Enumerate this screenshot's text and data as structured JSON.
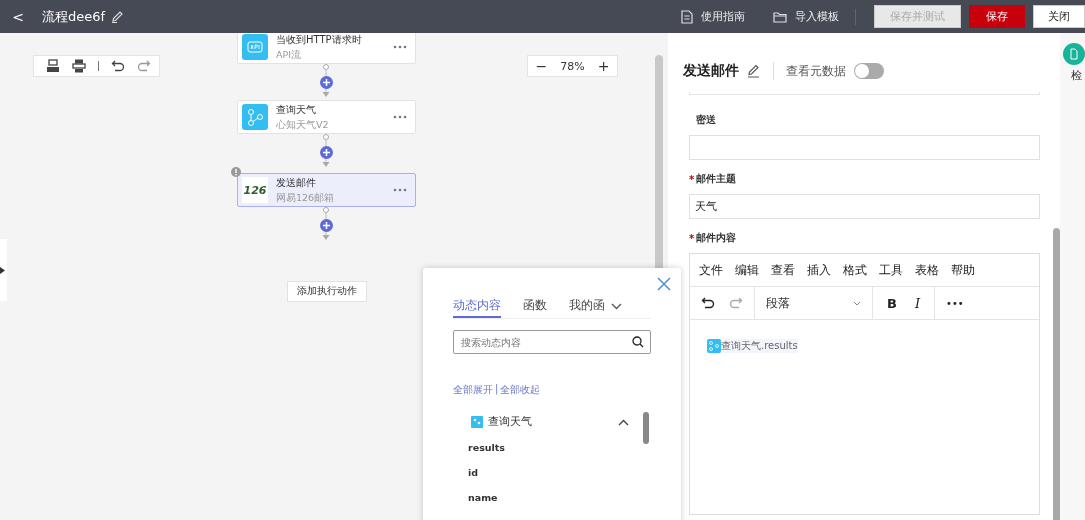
{
  "header": {
    "back": "<",
    "title": "流程dee6f",
    "actions": [
      {
        "kind": "guide",
        "label": "使用指南"
      },
      {
        "kind": "folder",
        "label": "导入模板"
      }
    ],
    "buttons": [
      {
        "label": "保存并测试",
        "kind": "default",
        "disabled": true
      },
      {
        "label": "保存",
        "kind": "primary",
        "disabled": false
      },
      {
        "label": "关闭",
        "kind": "default",
        "disabled": false
      }
    ]
  },
  "canvas": {
    "zoom": {
      "minus": "−",
      "value": "78%",
      "plus": "+"
    },
    "nodes": [
      {
        "title": "当收到HTTP请求时",
        "subtitle": "API流",
        "kind": "api",
        "selected": false,
        "warning": false
      },
      {
        "title": "查询天气",
        "subtitle": "心知天气V2",
        "kind": "share",
        "selected": false,
        "warning": false
      },
      {
        "title": "发送邮件",
        "subtitle": "网易126邮箱",
        "kind": "logo",
        "icon_text": "126",
        "selected": true,
        "warning": true
      }
    ],
    "add_action": "添加执行动作"
  },
  "popup": {
    "tabs": [
      {
        "label": "动态内容",
        "selected": true
      },
      {
        "label": "函数",
        "selected": false
      },
      {
        "label": "我的函",
        "selected": false
      }
    ],
    "search": {
      "placeholder": "搜索动态内容"
    },
    "expand_all": "全部展开",
    "separator": "|",
    "collapse_all": "全部收起",
    "tree": [
      {
        "label": "查询天气",
        "expanded": true,
        "children": [
          {
            "label": "results"
          },
          {
            "label": "id"
          },
          {
            "label": "name"
          }
        ]
      }
    ]
  },
  "panel": {
    "title": "发送邮件",
    "meta_label": "查看元数据",
    "meta_on": false,
    "required_mark": "*",
    "fields": [
      {
        "label": "密送",
        "required": false
      },
      {
        "label": "邮件主题",
        "required": true,
        "value": "天气"
      }
    ],
    "editor": {
      "label": "邮件内容",
      "required": true,
      "menu": [
        "文件",
        "编辑",
        "查看",
        "插入",
        "格式",
        "工具",
        "表格",
        "帮助"
      ],
      "block_format": "段落",
      "bold": "B",
      "italic": "I",
      "more": "•••",
      "content": "查询天气.results"
    }
  },
  "side": {
    "label": "检"
  }
}
